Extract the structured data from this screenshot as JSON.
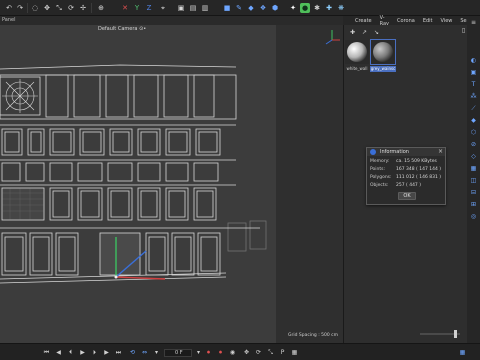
{
  "panel": {
    "label": "Panel"
  },
  "viewport": {
    "camera_label": "Default Camera ⊙•",
    "grid_spacing": "Grid Spacing : 500 cm"
  },
  "materials": {
    "menu": [
      "Create",
      "V-Ray",
      "Corona",
      "Edit",
      "View",
      "Select"
    ],
    "items": [
      {
        "name": "white_wall",
        "selected": false
      },
      {
        "name": "grey_wainsc",
        "selected": true
      }
    ]
  },
  "info_dialog": {
    "title": "Information",
    "rows": [
      {
        "label": "Memory:",
        "value": "ca. 15 509 KBytes"
      },
      {
        "label": "Points:",
        "value": "167 348 ( 147 144 )"
      },
      {
        "label": "Polygons:",
        "value": "111 012 ( 146 831 )"
      },
      {
        "label": "Objects:",
        "value": "257 ( 447 )"
      }
    ],
    "ok_label": "OK"
  },
  "timeline": {
    "frame": "0 F"
  },
  "colors": {
    "accent": "#4a6fc0",
    "viewport_bg": "#3c3c3c",
    "wire": "#e8e8e8",
    "axis_x": "#d04040",
    "axis_y": "#3cc060",
    "axis_z": "#3a6fd8"
  },
  "icons": [
    "undo-icon",
    "redo-icon",
    "cursor-icon",
    "move-icon",
    "scale-icon",
    "rotate-icon",
    "x-axis-icon",
    "y-axis-icon",
    "z-axis-icon",
    "cube-icon",
    "pen-icon",
    "light-icon",
    "play-icon",
    "record-icon",
    "camera-icon",
    "gear-icon"
  ]
}
